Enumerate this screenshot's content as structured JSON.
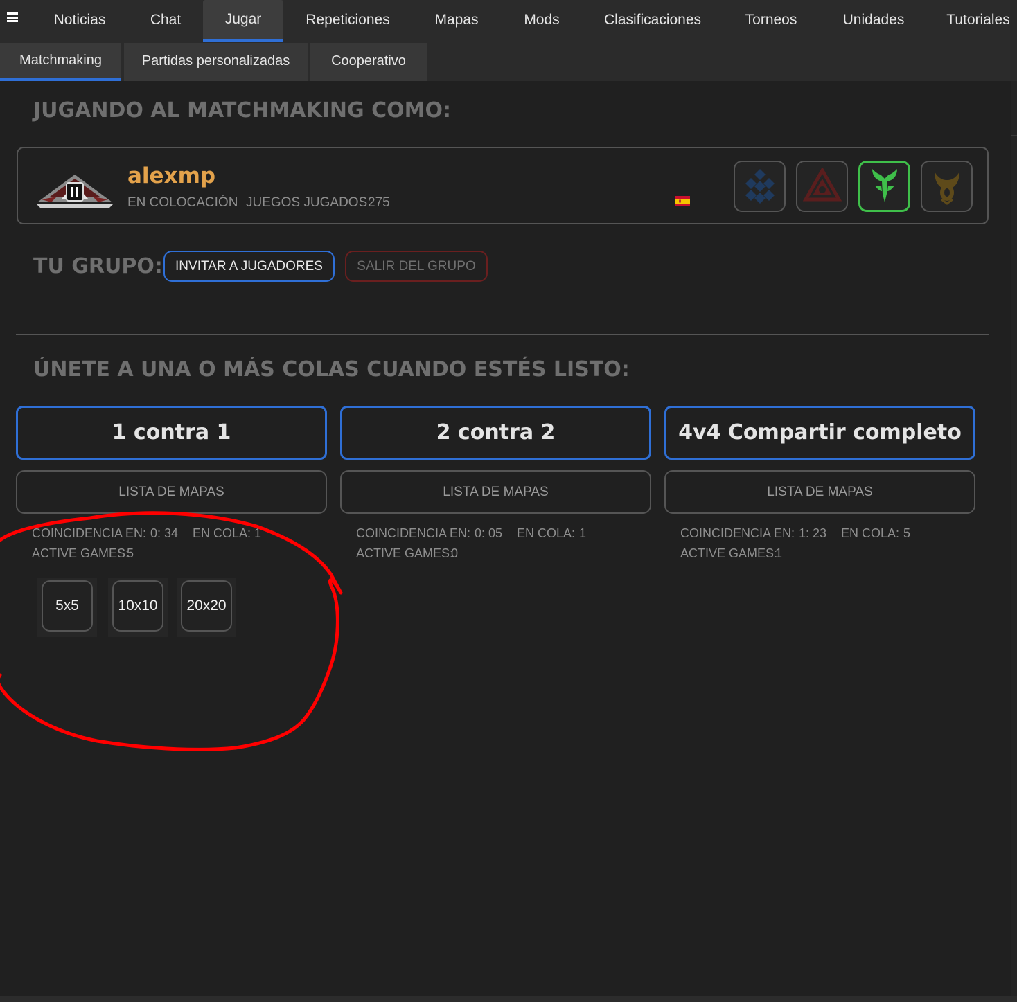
{
  "topnav": {
    "menu_icon": "hamburger-menu-icon",
    "tabs": [
      {
        "label": "Noticias"
      },
      {
        "label": "Chat"
      },
      {
        "label": "Jugar",
        "active": true
      },
      {
        "label": "Repeticiones"
      },
      {
        "label": "Mapas"
      },
      {
        "label": "Mods"
      },
      {
        "label": "Clasificaciones"
      },
      {
        "label": "Torneos"
      },
      {
        "label": "Unidades"
      },
      {
        "label": "Tutoriales"
      }
    ],
    "accent_color": "#2f6fd6"
  },
  "subnav": {
    "tabs": [
      {
        "label": "Matchmaking",
        "active": true
      },
      {
        "label": "Partidas personalizadas"
      },
      {
        "label": "Cooperativo"
      }
    ]
  },
  "matchmaking": {
    "heading": "JUGANDO AL MATCHMAKING COMO:",
    "profile": {
      "username": "alexmp",
      "status": "EN COLOCACIÓN",
      "games_played_label": "JUEGOS JUGADOS:",
      "games_played": "275",
      "rank_icon": "rank-emblem-icon",
      "flag_icon": "spain-flag-icon",
      "username_color": "#e3a24b",
      "races": [
        {
          "icon": "blue-race-icon",
          "color": "#1f3a5e"
        },
        {
          "icon": "red-race-icon",
          "color": "#5a1e1e"
        },
        {
          "icon": "green-race-icon",
          "color": "#3fbf4a",
          "selected": true
        },
        {
          "icon": "gold-race-icon",
          "color": "#5e4a1a"
        }
      ]
    }
  },
  "group": {
    "heading": "TU GRUPO:",
    "invite_label": "INVITAR A JUGADORES",
    "leave_label": "SALIR DEL GRUPO"
  },
  "queues": {
    "heading": "ÚNETE A UNA O MÁS COLAS CUANDO ESTÉS LISTO:",
    "map_list_label": "LISTA DE MAPAS",
    "match_label": "COINCIDENCIA EN:",
    "queue_label": "EN COLA:",
    "active_label": "ACTIVE GAMES:",
    "items": [
      {
        "name": "1 contra 1",
        "match_time": "0: 34",
        "in_queue": "1",
        "active_games": "5"
      },
      {
        "name": "2 contra 2",
        "match_time": "0: 05",
        "in_queue": "1",
        "active_games": "0"
      },
      {
        "name": "4v4 Compartir completo",
        "match_time": "1: 23",
        "in_queue": "5",
        "active_games": "1"
      }
    ],
    "map_sizes": [
      "5x5",
      "10x10",
      "20x20"
    ]
  },
  "annotation": {
    "color": "#ff0000",
    "shape": "hand-drawn circle"
  }
}
